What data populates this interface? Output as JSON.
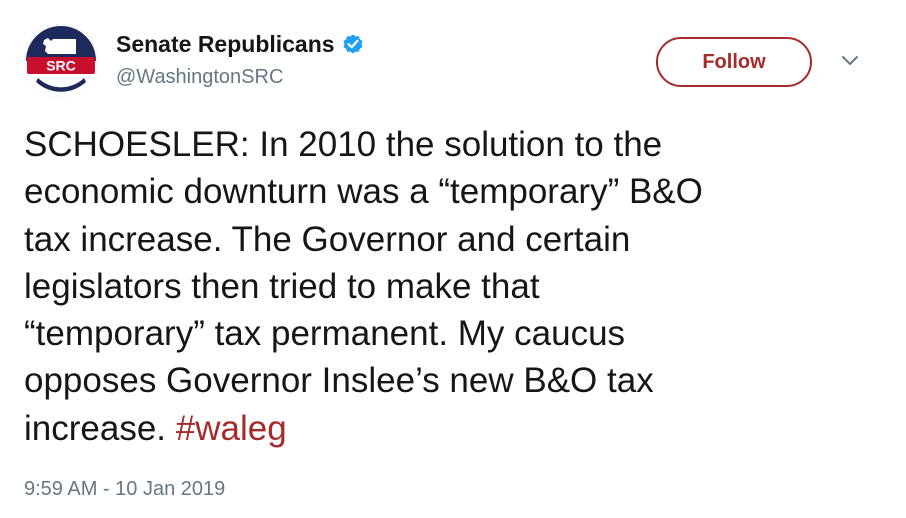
{
  "user": {
    "display_name": "Senate Republicans",
    "handle": "@WashingtonSRC",
    "verified": true,
    "avatar_text": "SRC"
  },
  "actions": {
    "follow_label": "Follow"
  },
  "tweet": {
    "text": "SCHOESLER:  In 2010 the solution to the\neconomic downturn was a “temporary” B&O\ntax increase. The Governor and certain\nlegislators then tried to make that\n“temporary” tax permanent.  My caucus\nopposes Governor Inslee’s new B&O tax\nincrease.",
    "hashtag": "#waleg",
    "timestamp": "9:59 AM - 10 Jan 2019"
  },
  "colors": {
    "accent": "#a52a2a",
    "verified": "#1da1f2",
    "secondary_text": "#657786",
    "avatar_navy": "#1f2a5c",
    "avatar_red": "#c8102e"
  },
  "icons": {
    "verified": "verified-badge-icon",
    "menu": "chevron-down-icon"
  }
}
